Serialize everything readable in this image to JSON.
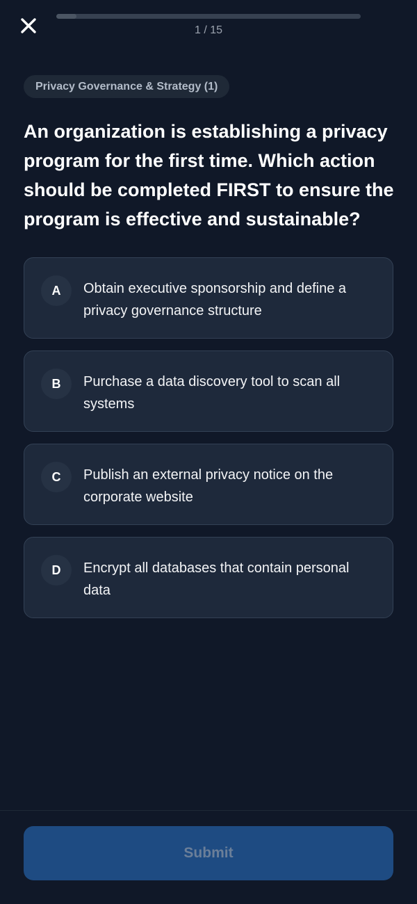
{
  "header": {
    "close_icon": "close-icon",
    "progress_text": "1 / 15",
    "progress_fraction": 0.0667
  },
  "category": {
    "label": "Privacy Governance & Strategy (1)"
  },
  "question": {
    "text": "An organization is establishing a privacy program for the first time. Which action should be completed FIRST to ensure the program is effective and sustainable?"
  },
  "options": [
    {
      "letter": "A",
      "text": "Obtain executive sponsorship and define a privacy governance structure"
    },
    {
      "letter": "B",
      "text": "Purchase a data discovery tool to scan all systems"
    },
    {
      "letter": "C",
      "text": "Publish an external privacy notice on the corporate website"
    },
    {
      "letter": "D",
      "text": "Encrypt all databases that contain personal data"
    }
  ],
  "footer": {
    "submit_label": "Submit",
    "submit_state": "disabled"
  },
  "colors": {
    "background": "#101828",
    "card": "#1e293b",
    "submit_disabled": "#1e4b82"
  }
}
